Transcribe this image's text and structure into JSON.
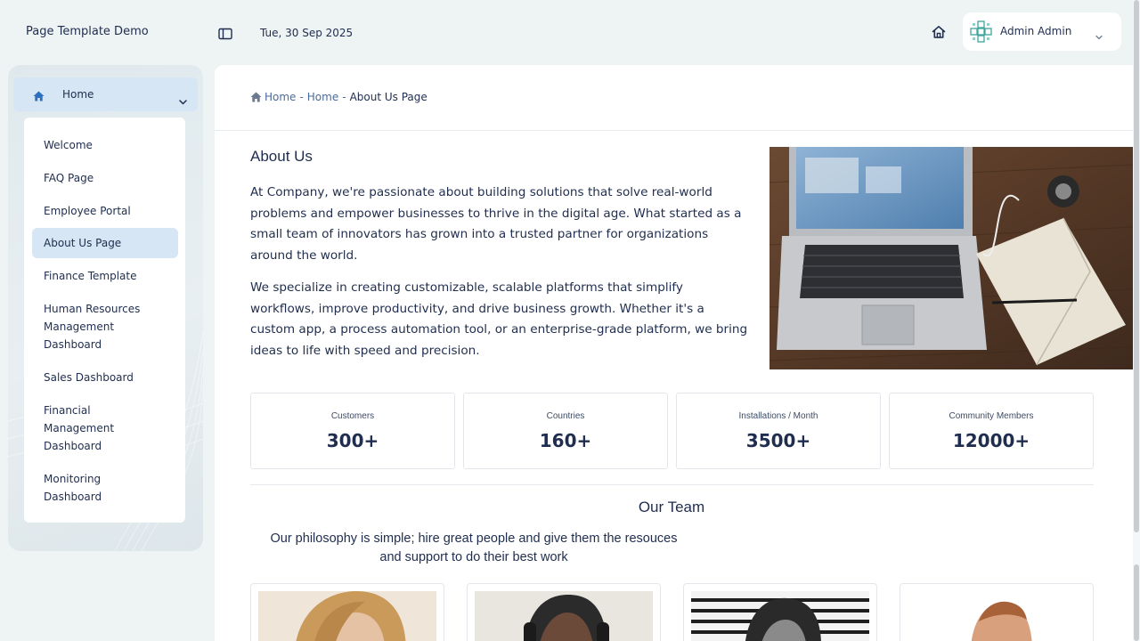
{
  "header": {
    "app_title": "Page Template Demo",
    "date": "Tue, 30 Sep 2025",
    "user_name": "Admin Admin"
  },
  "sidebar": {
    "home_label": "Home",
    "items": [
      {
        "label": "Welcome"
      },
      {
        "label": "FAQ Page"
      },
      {
        "label": "Employee Portal"
      },
      {
        "label": "About Us Page",
        "active": true
      },
      {
        "label": "Finance Template"
      },
      {
        "label": "Human Resources Management Dashboard"
      },
      {
        "label": "Sales Dashboard"
      },
      {
        "label": "Financial Management Dashboard"
      },
      {
        "label": "Monitoring Dashboard"
      }
    ]
  },
  "breadcrumb": {
    "items": [
      "Home",
      "Home"
    ],
    "separator": "-",
    "current": "About Us Page"
  },
  "about": {
    "title": "About Us",
    "paragraphs": [
      "At Company, we're passionate about building solutions that solve real-world problems and empower businesses to thrive in the digital age. What started as a small team of innovators has grown into a trusted partner for organizations around the world.",
      "We specialize in creating customizable, scalable platforms that simplify workflows, improve productivity, and drive business growth. Whether it's a custom app, a process automation tool, or an enterprise-grade platform, we bring ideas to life with speed and precision."
    ]
  },
  "stats": [
    {
      "label": "Customers",
      "value": "300+"
    },
    {
      "label": "Countries",
      "value": "160+"
    },
    {
      "label": "Installations / Month",
      "value": "3500+"
    },
    {
      "label": "Community Members",
      "value": "12000+"
    }
  ],
  "team": {
    "title": "Our Team",
    "description": "Our philosophy is simple; hire great people and give them the resouces and support to do their best work"
  },
  "colors": {
    "accent": "#1f2d4e",
    "active_bg": "#d6e6f4",
    "page_bg": "#eef3f4"
  }
}
